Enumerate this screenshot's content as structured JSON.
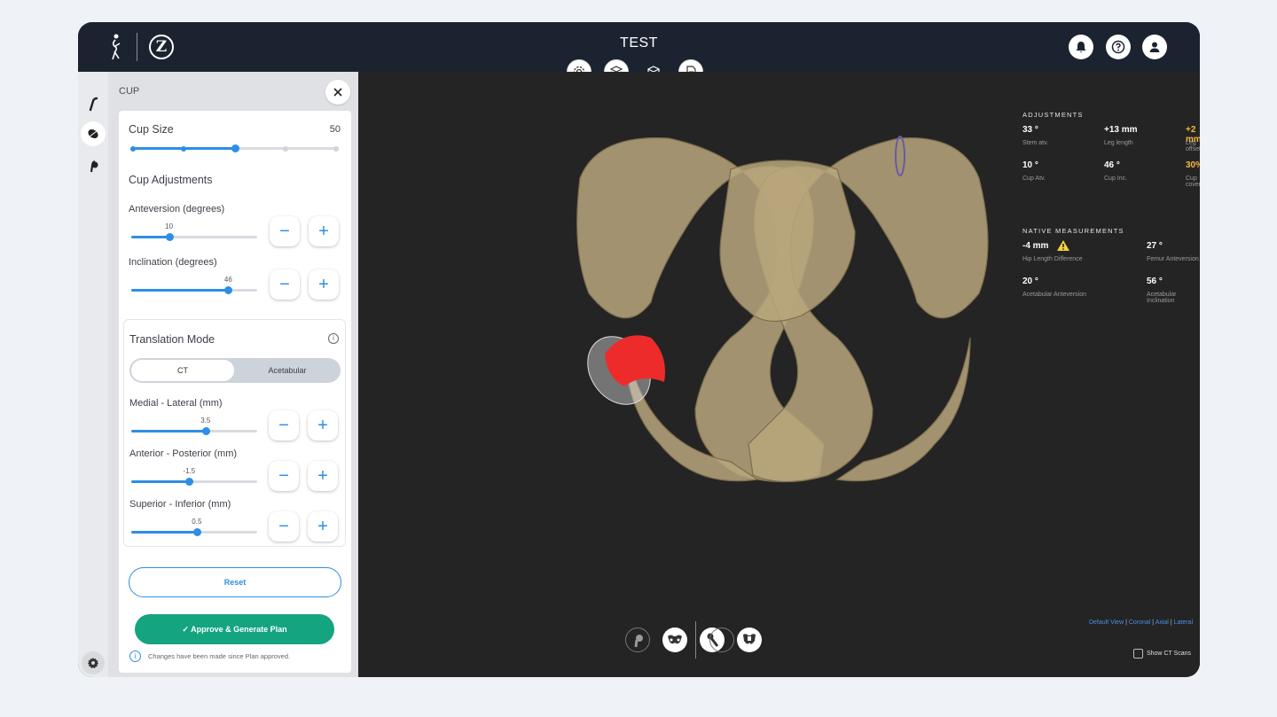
{
  "app": {
    "title": "TEST"
  },
  "panel": {
    "title": "CUP",
    "cup_size": {
      "label": "Cup Size",
      "value": "50",
      "level": 0.5
    },
    "cup_adjustments_label": "Cup Adjustments",
    "anteversion": {
      "label": "Anteversion (degrees)",
      "value": "10",
      "level": 0.3
    },
    "inclination": {
      "label": "Inclination (degrees)",
      "value": "46",
      "level": 0.77
    },
    "translation": {
      "label": "Translation Mode",
      "modes": [
        "CT",
        "Acetabular"
      ],
      "selected": "CT",
      "medial_lateral": {
        "label": "Medial - Lateral (mm)",
        "value": "3.5",
        "level": 0.59
      },
      "anterior_posterior": {
        "label": "Anterior - Posterior (mm)",
        "value": "-1.5",
        "level": 0.46
      },
      "superior_inferior": {
        "label": "Superior - Inferior (mm)",
        "value": "0.5",
        "level": 0.52
      }
    },
    "stepper": {
      "minus": "−",
      "plus": "+"
    },
    "reset_label": "Reset",
    "approve_label": "✓  Approve & Generate Plan",
    "note": "Changes have been made since Plan approved."
  },
  "adjustments": {
    "heading": "ADJUSTMENTS",
    "items": [
      {
        "value": "33 °",
        "label": "Stem atv.",
        "warn": false
      },
      {
        "value": "+13 mm",
        "label": "Leg length",
        "warn": false
      },
      {
        "value": "+2 mm",
        "label": "Leg offset",
        "warn": true
      },
      {
        "value": "10 °",
        "label": "Cup Atv.",
        "warn": false
      },
      {
        "value": "46 °",
        "label": "Cup Inc.",
        "warn": false
      },
      {
        "value": "30%",
        "label": "Cup coverage",
        "warn": true
      }
    ]
  },
  "native": {
    "heading": "NATIVE MEASUREMENTS",
    "items": [
      {
        "value": "-4 mm",
        "label": "Hip Length Difference",
        "warn": true
      },
      {
        "value": "27 °",
        "label": "Femur Anteversion",
        "warn": false
      },
      {
        "value": "20 °",
        "label": "Acetabular Anteversion",
        "warn": false
      },
      {
        "value": "56 °",
        "label": "Acetabular Inclination",
        "warn": false
      }
    ]
  },
  "view_links": [
    "Default View",
    "Coronal",
    "Axial",
    "Lateral"
  ],
  "show_ct_label": "Show CT Scans",
  "colors": {
    "accent": "#2d8ee6",
    "approve": "#14a480",
    "warning": "#f6b93b",
    "topbar": "#1c2330"
  },
  "icons": {
    "toolbar": [
      "settings-icon",
      "layers-icon",
      "cube-icon",
      "document-icon"
    ],
    "top_right": [
      "bell-icon",
      "help-icon",
      "user-icon"
    ],
    "bottom": [
      "femur-view-icon",
      "pelvis-view-icon",
      "stem-view-icon",
      "pelvis-front-view-icon",
      "radiograph-icon"
    ]
  }
}
